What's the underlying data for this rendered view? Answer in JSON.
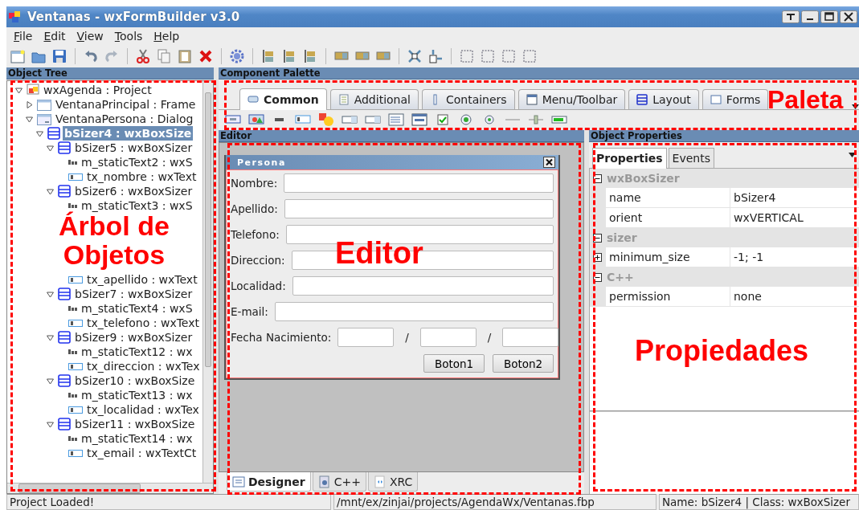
{
  "window": {
    "title": "Ventanas - wxFormBuilder v3.0"
  },
  "menu": [
    "File",
    "Edit",
    "View",
    "Tools",
    "Help"
  ],
  "object_tree": {
    "title": "Object Tree",
    "items": [
      {
        "label": "wxAgenda : Project",
        "kind": "project",
        "expanded": true,
        "selected": false,
        "children": [
          {
            "label": "VentanaPrincipal : Frame",
            "kind": "frame",
            "expanded": false,
            "selected": false
          },
          {
            "label": "VentanaPersona : Dialog",
            "kind": "dialog",
            "expanded": true,
            "selected": false,
            "children": [
              {
                "label": "bSizer4 : wxBoxSize",
                "kind": "sizer",
                "expanded": true,
                "selected": true,
                "children": [
                  {
                    "label": "bSizer5 : wxBoxSizer",
                    "kind": "sizer",
                    "expanded": true,
                    "selected": false,
                    "children": [
                      {
                        "label": "m_staticText2 : wxS",
                        "kind": "statictext",
                        "selected": false
                      },
                      {
                        "label": "tx_nombre : wxText",
                        "kind": "textctrl",
                        "selected": false
                      }
                    ]
                  },
                  {
                    "label": "bSizer6 : wxBoxSizer",
                    "kind": "sizer",
                    "expanded": true,
                    "selected": false,
                    "children": [
                      {
                        "label": "m_staticText3 : wxS",
                        "kind": "statictext",
                        "selected": false
                      },
                      {
                        "label": "tx_apellido : wxText",
                        "kind": "textctrl",
                        "selected": false
                      }
                    ]
                  },
                  {
                    "label": "bSizer7 : wxBoxSizer",
                    "kind": "sizer",
                    "expanded": true,
                    "selected": false,
                    "children": [
                      {
                        "label": "m_staticText4 : wxS",
                        "kind": "statictext",
                        "selected": false
                      },
                      {
                        "label": "tx_telefono : wxText",
                        "kind": "textctrl",
                        "selected": false
                      }
                    ]
                  },
                  {
                    "label": "bSizer9 : wxBoxSizer",
                    "kind": "sizer",
                    "expanded": true,
                    "selected": false,
                    "children": [
                      {
                        "label": "m_staticText12 : wx",
                        "kind": "statictext",
                        "selected": false
                      },
                      {
                        "label": "tx_direccion : wxTex",
                        "kind": "textctrl",
                        "selected": false
                      }
                    ]
                  },
                  {
                    "label": "bSizer10 : wxBoxSize",
                    "kind": "sizer",
                    "expanded": true,
                    "selected": false,
                    "children": [
                      {
                        "label": "m_staticText13 : wx",
                        "kind": "statictext",
                        "selected": false
                      },
                      {
                        "label": "tx_localidad : wxTex",
                        "kind": "textctrl",
                        "selected": false
                      }
                    ]
                  },
                  {
                    "label": "bSizer11 : wxBoxSize",
                    "kind": "sizer",
                    "expanded": true,
                    "selected": false,
                    "children": [
                      {
                        "label": "m_staticText14 : wx",
                        "kind": "statictext",
                        "selected": false
                      },
                      {
                        "label": "tx_email : wxTextCt",
                        "kind": "textctrl",
                        "selected": false
                      }
                    ]
                  }
                ]
              }
            ]
          }
        ]
      }
    ]
  },
  "component_palette": {
    "title": "Component Palette",
    "tabs": [
      {
        "label": "Common",
        "selected": true
      },
      {
        "label": "Additional",
        "selected": false
      },
      {
        "label": "Containers",
        "selected": false
      },
      {
        "label": "Menu/Toolbar",
        "selected": false
      },
      {
        "label": "Layout",
        "selected": false
      },
      {
        "label": "Forms",
        "selected": false
      }
    ]
  },
  "editor": {
    "title": "Editor",
    "dialog": {
      "title": "Persona",
      "fields": [
        {
          "label": "Nombre:"
        },
        {
          "label": "Apellido:"
        },
        {
          "label": "Telefono:"
        },
        {
          "label": "Direccion:"
        },
        {
          "label": "Localidad:"
        },
        {
          "label": "E-mail:"
        }
      ],
      "date_field": {
        "label": "Fecha Nacimiento:",
        "separators": [
          "/",
          "/"
        ]
      },
      "buttons": [
        "Boton1",
        "Boton2"
      ]
    },
    "tabs": [
      {
        "label": "Designer",
        "selected": true
      },
      {
        "label": "C++",
        "selected": false
      },
      {
        "label": "XRC",
        "selected": false
      }
    ]
  },
  "object_properties": {
    "title": "Object Properties",
    "tabs": [
      {
        "label": "Properties",
        "selected": true
      },
      {
        "label": "Events",
        "selected": false
      }
    ],
    "groups": [
      {
        "name": "wxBoxSizer",
        "expanded": true,
        "properties": [
          {
            "name": "name",
            "value": "bSizer4"
          },
          {
            "name": "orient",
            "value": "wxVERTICAL"
          }
        ]
      },
      {
        "name": "sizer",
        "expanded": true,
        "properties": [
          {
            "name": "minimum_size",
            "value": "-1; -1",
            "expanded": false
          }
        ]
      },
      {
        "name": "C++",
        "expanded": true,
        "properties": [
          {
            "name": "permission",
            "value": "none"
          }
        ]
      }
    ]
  },
  "status_bar": [
    "Project Loaded!",
    "/mnt/ex/zinjai/projects/AgendaWx/Ventanas.fbp",
    "Name: bSizer4 | Class: wxBoxSizer"
  ],
  "annotations": [
    {
      "label": "Árbol de Objetos"
    },
    {
      "label": "Paleta"
    },
    {
      "label": "Editor"
    },
    {
      "label": "Propiedades"
    }
  ]
}
